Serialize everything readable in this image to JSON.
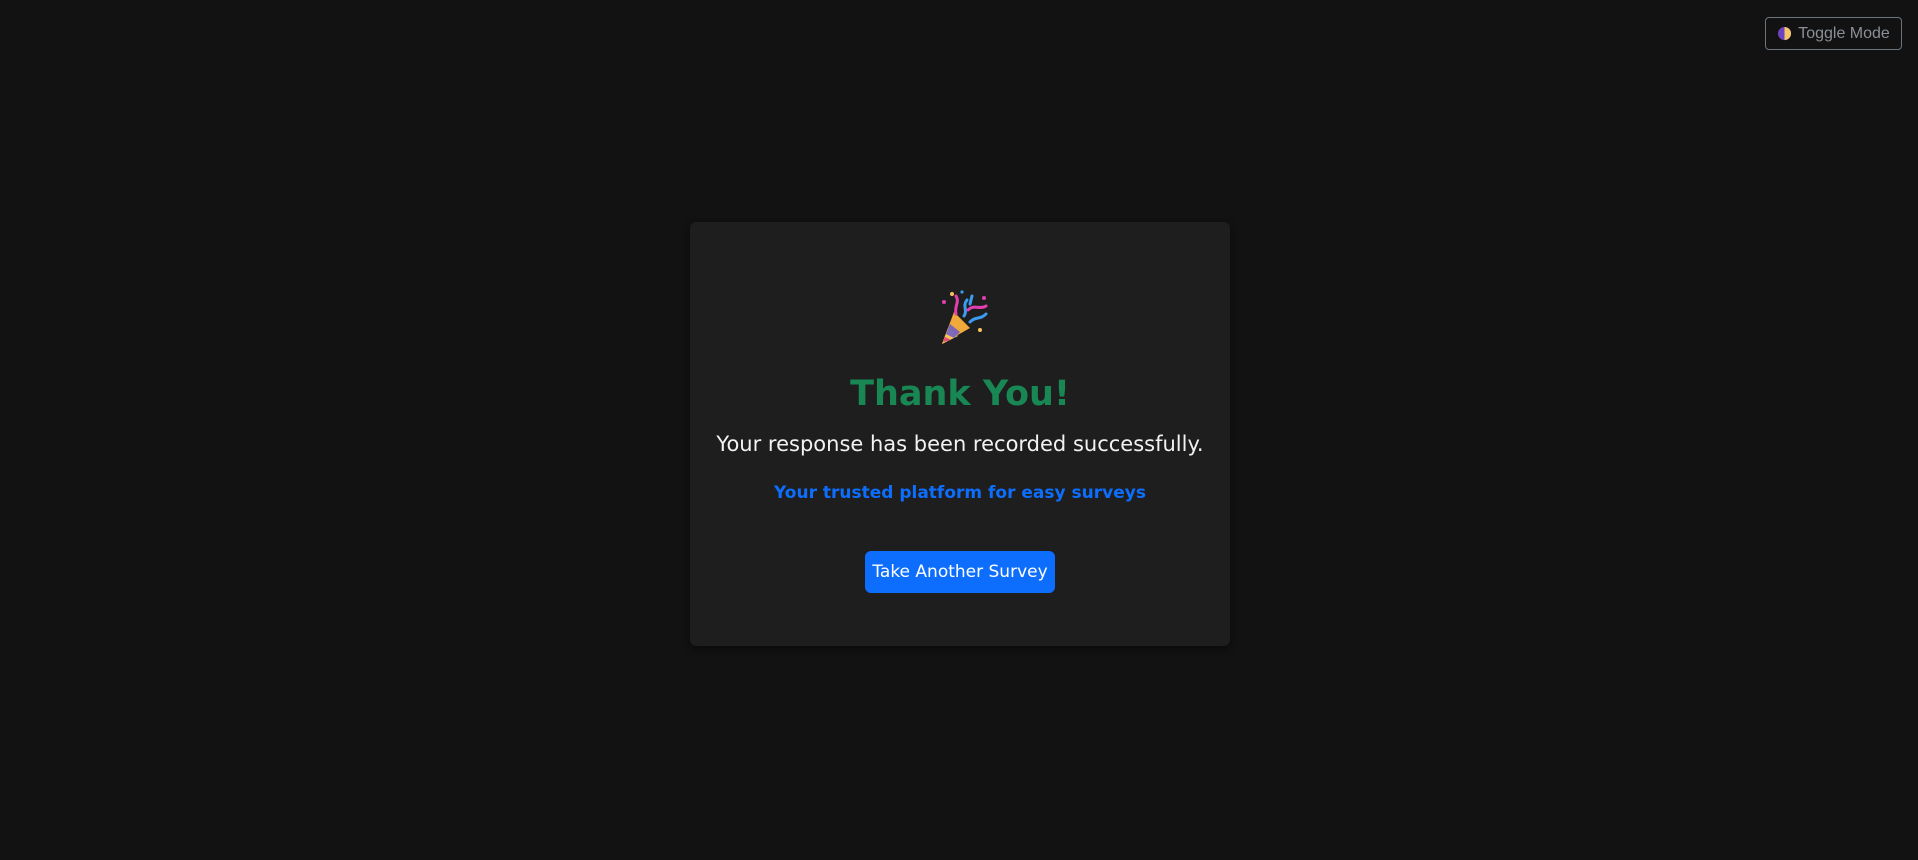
{
  "header": {
    "toggle_label": "Toggle Mode",
    "toggle_icon": "half-circle-icon"
  },
  "card": {
    "icon": "party-popper-icon",
    "title": "Thank You!",
    "message": "Your response has been recorded successfully.",
    "tagline": "Your trusted platform for easy surveys",
    "button_label": "Take Another Survey"
  },
  "colors": {
    "background": "#121212",
    "card": "#1e1e1e",
    "success": "#198754",
    "primary": "#0d6efd",
    "muted": "#6c757d"
  }
}
